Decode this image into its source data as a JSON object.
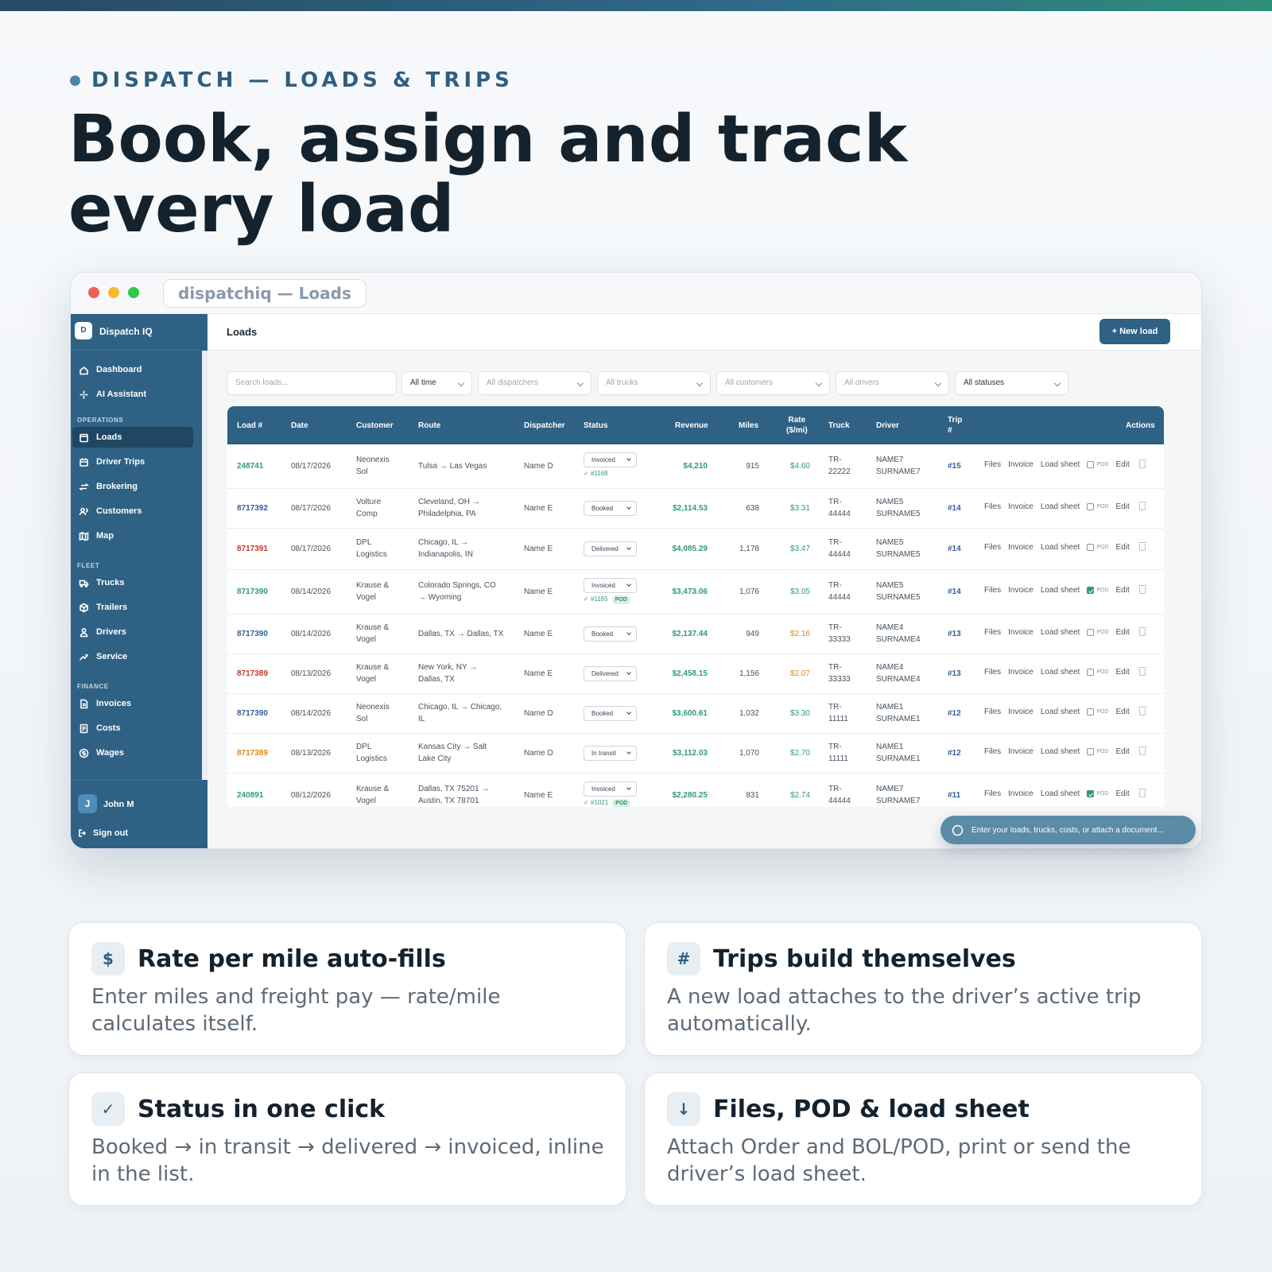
{
  "eyebrow": "DISPATCH — LOADS & TRIPS",
  "headline_line1": "Book, assign and track",
  "headline_line2": "every load",
  "window": {
    "tab_title": "dispatchiq — Loads"
  },
  "app": {
    "brand_initial": "D",
    "brand_name": "Dispatch IQ",
    "nav_top": [
      {
        "label": "Dashboard",
        "icon": "home-icon"
      },
      {
        "label": "AI Assistant",
        "icon": "sparkle-icon"
      }
    ],
    "sections": [
      {
        "title": "OPERATIONS",
        "items": [
          {
            "label": "Loads",
            "icon": "clipboard-icon",
            "active": true
          },
          {
            "label": "Driver Trips",
            "icon": "calendar-icon"
          },
          {
            "label": "Brokering",
            "icon": "swap-icon"
          },
          {
            "label": "Customers",
            "icon": "users-icon"
          },
          {
            "label": "Map",
            "icon": "map-icon"
          }
        ]
      },
      {
        "title": "FLEET",
        "items": [
          {
            "label": "Trucks",
            "icon": "truck-icon"
          },
          {
            "label": "Trailers",
            "icon": "box-icon"
          },
          {
            "label": "Drivers",
            "icon": "person-icon"
          },
          {
            "label": "Service",
            "icon": "wrench-icon"
          }
        ]
      },
      {
        "title": "FINANCE",
        "items": [
          {
            "label": "Invoices",
            "icon": "document-icon"
          },
          {
            "label": "Costs",
            "icon": "receipt-icon"
          },
          {
            "label": "Wages",
            "icon": "dollar-circle-icon"
          }
        ]
      }
    ],
    "user_initial": "J",
    "user_name": "John M",
    "signout": "Sign out",
    "page_title": "Loads",
    "new_load": "+ New load",
    "filters": {
      "search_placeholder": "Search loads...",
      "time": "All time",
      "dispatchers": "All dispatchers",
      "trucks": "All trucks",
      "customers": "All customers",
      "drivers": "All drivers",
      "statuses": "All statuses"
    },
    "columns": {
      "load": "Load #",
      "date": "Date",
      "customer": "Customer",
      "route": "Route",
      "dispatcher": "Dispatcher",
      "status": "Status",
      "revenue": "Revenue",
      "miles": "Miles",
      "rate_line1": "Rate",
      "rate_line2": "($/mi)",
      "truck": "Truck",
      "driver": "Driver",
      "trip_line1": "Trip",
      "trip_line2": "#",
      "actions": "Actions"
    },
    "actions": {
      "files": "Files",
      "invoice": "Invoice",
      "load_sheet": "Load sheet",
      "pod": "POD",
      "edit": "Edit"
    },
    "rows": [
      {
        "load": "248741",
        "load_color": "#2f9d6c",
        "date": "08/17/2026",
        "customer1": "Neonexis",
        "customer2": "Sol",
        "route1": "Tulsa → Las Vegas",
        "route2": "",
        "dispatcher": "Name D",
        "status": "Invoiced",
        "inv": "✓ #1168",
        "pod_badge": "",
        "revenue": "$4,210",
        "miles": "915",
        "rate": "$4.60",
        "rate_color": "#2f9d6c",
        "truck1": "TR-",
        "truck2": "22222",
        "driver1": "NAME7",
        "driver2": "SURNAME7",
        "trip": "#15",
        "pod_checked": false
      },
      {
        "load": "8717392",
        "load_color": "#2f5f9a",
        "date": "08/17/2026",
        "customer1": "Volture",
        "customer2": "Comp",
        "route1": "Cleveland, OH →",
        "route2": "Philadelphia, PA",
        "dispatcher": "Name E",
        "status": "Booked",
        "inv": "",
        "pod_badge": "",
        "revenue": "$2,114.53",
        "miles": "638",
        "rate": "$3.31",
        "rate_color": "#2f9d6c",
        "truck1": "TR-",
        "truck2": "44444",
        "driver1": "NAME5",
        "driver2": "SURNAME5",
        "trip": "#14",
        "pod_checked": false
      },
      {
        "load": "8717391",
        "load_color": "#c0392b",
        "date": "08/17/2026",
        "customer1": "DPL",
        "customer2": "Logistics",
        "route1": "Chicago, IL →",
        "route2": "Indianapolis, IN",
        "dispatcher": "Name E",
        "status": "Delivered",
        "inv": "",
        "pod_badge": "",
        "revenue": "$4,085.29",
        "miles": "1,178",
        "rate": "$3.47",
        "rate_color": "#2f9d6c",
        "truck1": "TR-",
        "truck2": "44444",
        "driver1": "NAME5",
        "driver2": "SURNAME5",
        "trip": "#14",
        "pod_checked": false
      },
      {
        "load": "8717390",
        "load_color": "#2f9d6c",
        "date": "08/14/2026",
        "customer1": "Krause &",
        "customer2": "Vogel",
        "route1": "Colorado Springs, CO",
        "route2": "→ Wyoming",
        "dispatcher": "Name E",
        "status": "Invoiced",
        "inv": "✓ #1165",
        "pod_badge": "POD",
        "revenue": "$3,473.06",
        "miles": "1,076",
        "rate": "$3.05",
        "rate_color": "#2f9d6c",
        "truck1": "TR-",
        "truck2": "44444",
        "driver1": "NAME5",
        "driver2": "SURNAME5",
        "trip": "#14",
        "pod_checked": true
      },
      {
        "load": "8717390",
        "load_color": "#2f5f9a",
        "date": "08/14/2026",
        "customer1": "Krause &",
        "customer2": "Vogel",
        "route1": "Dallas, TX → Dallas, TX",
        "route2": "",
        "dispatcher": "Name E",
        "status": "Booked",
        "inv": "",
        "pod_badge": "",
        "revenue": "$2,137.44",
        "miles": "949",
        "rate": "$2.16",
        "rate_color": "#e08a1e",
        "truck1": "TR-",
        "truck2": "33333",
        "driver1": "NAME4",
        "driver2": "SURNAME4",
        "trip": "#13",
        "pod_checked": false
      },
      {
        "load": "8717389",
        "load_color": "#c0392b",
        "date": "08/13/2026",
        "customer1": "Krause &",
        "customer2": "Vogel",
        "route1": "New York, NY →",
        "route2": "Dallas, TX",
        "dispatcher": "Name E",
        "status": "Delivered",
        "inv": "",
        "pod_badge": "",
        "revenue": "$2,458.15",
        "miles": "1,156",
        "rate": "$2.07",
        "rate_color": "#e08a1e",
        "truck1": "TR-",
        "truck2": "33333",
        "driver1": "NAME4",
        "driver2": "SURNAME4",
        "trip": "#13",
        "pod_checked": false
      },
      {
        "load": "8717390",
        "load_color": "#2f5f9a",
        "date": "08/14/2026",
        "customer1": "Neonexis",
        "customer2": "Sol",
        "route1": "Chicago, IL → Chicago,",
        "route2": "IL",
        "dispatcher": "Name D",
        "status": "Booked",
        "inv": "",
        "pod_badge": "",
        "revenue": "$3,600.61",
        "miles": "1,032",
        "rate": "$3.30",
        "rate_color": "#2f9d6c",
        "truck1": "TR-",
        "truck2": "11111",
        "driver1": "NAME1",
        "driver2": "SURNAME1",
        "trip": "#12",
        "pod_checked": false
      },
      {
        "load": "8717389",
        "load_color": "#e08a1e",
        "date": "08/13/2026",
        "customer1": "DPL",
        "customer2": "Logistics",
        "route1": "Kansas City → Salt",
        "route2": "Lake City",
        "dispatcher": "Name D",
        "status": "In transit",
        "inv": "",
        "pod_badge": "",
        "revenue": "$3,112.03",
        "miles": "1,070",
        "rate": "$2.70",
        "rate_color": "#2f9d6c",
        "truck1": "TR-",
        "truck2": "11111",
        "driver1": "NAME1",
        "driver2": "SURNAME1",
        "trip": "#12",
        "pod_checked": false
      },
      {
        "load": "240891",
        "load_color": "#2f9d6c",
        "date": "08/12/2026",
        "customer1": "Krause &",
        "customer2": "Vogel",
        "route1": "Dallas, TX 75201 →",
        "route2": "Austin, TX 78701",
        "dispatcher": "Name E",
        "status": "Invoiced",
        "inv": "✓ #1021",
        "pod_badge": "POD",
        "revenue": "$2,280.25",
        "miles": "831",
        "rate": "$2.74",
        "rate_color": "#2f9d6c",
        "truck1": "TR-",
        "truck2": "44444",
        "driver1": "NAME7",
        "driver2": "SURNAME7",
        "trip": "#11",
        "pod_checked": true
      }
    ],
    "ai_placeholder": "Enter your loads, trucks, costs, or attach a document..."
  },
  "features": [
    {
      "icon": "$",
      "title": "Rate per mile auto-fills",
      "desc": "Enter miles and freight pay — rate/mile calculates itself."
    },
    {
      "icon": "#",
      "title": "Trips build themselves",
      "desc": "A new load attaches to the driver’s active trip automatically."
    },
    {
      "icon": "✓",
      "title": "Status in one click",
      "desc": "Booked → in transit → delivered → invoiced, inline in the list."
    },
    {
      "icon": "↓",
      "title": "Files, POD & load sheet",
      "desc": "Attach Order and BOL/POD, print or send the driver’s load sheet."
    }
  ]
}
